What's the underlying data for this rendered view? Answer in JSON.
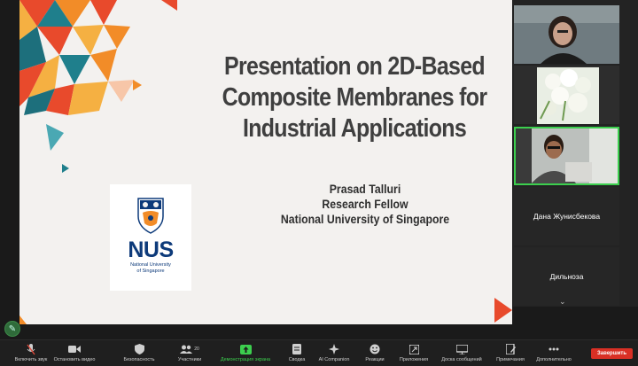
{
  "slide": {
    "title_lines": [
      "Presentation on 2D-Based",
      "Composite Membranes for",
      "Industrial Applications"
    ],
    "presenter_name": "Prasad Talluri",
    "presenter_role": "Research Fellow",
    "presenter_org": "National University of Singapore",
    "logo_word": "NUS",
    "logo_sub_lines": [
      "National University",
      "of Singapore"
    ],
    "logo_color": "#0d3a7a"
  },
  "participants": [
    {
      "kind": "video",
      "icon": "participant-woman-video"
    },
    {
      "kind": "video",
      "icon": "participant-flowers-video"
    },
    {
      "kind": "video",
      "icon": "participant-man-video",
      "active": true
    },
    {
      "kind": "name",
      "name": "Дана Жунисбекова"
    },
    {
      "kind": "name",
      "name": "Дильноза"
    }
  ],
  "toolbar": {
    "unmute": "Включить звук",
    "stop_video": "Остановить видео",
    "security": "Безопасность",
    "participants": "Участники",
    "participants_count": "20",
    "share_screen": "Демонстрация экрана",
    "summary": "Сводка",
    "ai_companion": "AI Companion",
    "reactions": "Реакции",
    "apps": "Приложения",
    "whiteboards": "Доска сообщений",
    "notes": "Примечания",
    "more": "Дополнительно",
    "end": "Завершить"
  },
  "colors": {
    "active_green": "#3ccf4e",
    "end_red": "#d93025"
  }
}
